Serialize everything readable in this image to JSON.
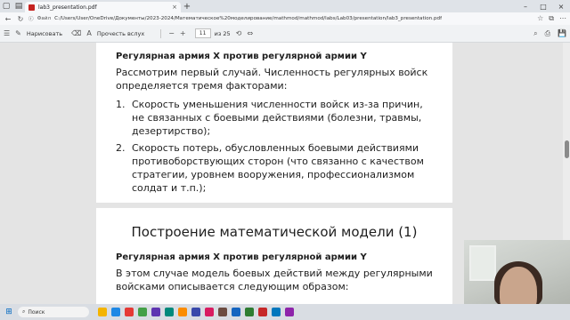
{
  "browser": {
    "tab_title": "lab3_presentation.pdf",
    "tab_close": "×",
    "new_tab": "+",
    "address_prefix": "Файл",
    "url": "C:/Users/User/OneDrive/Документы/2023-2024/Математическое%20моделирование/mathmod/mathmod/labs/Lab03/presentation/lab3_presentation.pdf",
    "window_controls": [
      "–",
      "□",
      "×"
    ]
  },
  "pdf_toolbar": {
    "draw_label": "Нарисовать",
    "read_aloud_label": "Прочесть вслух",
    "current_page": "11",
    "page_total": "из 25"
  },
  "page1": {
    "subtitle": "Регулярная армия X против регулярной армии Y",
    "intro": "Рассмотрим первый случай. Численность регулярных войск определяется тремя факторами:",
    "items": [
      {
        "num": "1.",
        "text": "Скорость уменьшения численности войск из-за причин, не связанных с боевыми действиями (болезни, травмы, дезертирство);"
      },
      {
        "num": "2.",
        "text": "Скорость потерь, обусловленных боевыми действиями противоборствующих сторон (что связанно с качеством стратегии, уровнем вооружения, профессионализмом солдат и т.п.);"
      }
    ]
  },
  "page2": {
    "title": "Построение математической модели (1)",
    "subtitle": "Регулярная армия X против регулярной армии Y",
    "intro": "В этом случае модель боевых действий между регулярными войсками описывается следующим образом:"
  },
  "taskbar": {
    "search_placeholder": "Поиск",
    "app_colors": [
      "#f4b400",
      "#1e88e5",
      "#e53935",
      "#43a047",
      "#5e35b1",
      "#00897b",
      "#fb8c00",
      "#3949ab",
      "#d81b60",
      "#6d4c41",
      "#1565c0",
      "#2e7d32",
      "#c62828",
      "#0277bd",
      "#8e24aa"
    ]
  },
  "colors": {
    "pdf_red": "#c5221f",
    "windows_blue": "#0067c0"
  }
}
